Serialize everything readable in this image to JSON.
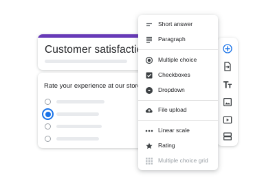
{
  "form": {
    "title": "Customer satisfaction",
    "question": "Rate your experience at our store",
    "accent_color": "#673ab7"
  },
  "question_options": [
    {
      "selected": false
    },
    {
      "selected": true
    },
    {
      "selected": false
    },
    {
      "selected": false
    }
  ],
  "menu": {
    "items": [
      {
        "label": "Short answer",
        "icon": "short-text-icon"
      },
      {
        "label": "Paragraph",
        "icon": "paragraph-icon"
      },
      {
        "label": "Multiple choice",
        "icon": "radio-button-icon"
      },
      {
        "label": "Checkboxes",
        "icon": "checkbox-icon"
      },
      {
        "label": "Dropdown",
        "icon": "dropdown-circle-icon"
      },
      {
        "label": "File upload",
        "icon": "cloud-upload-icon"
      },
      {
        "label": "Linear scale",
        "icon": "dots-icon"
      },
      {
        "label": "Rating",
        "icon": "star-icon"
      },
      {
        "label": "Multiple choice grid",
        "icon": "grid-icon",
        "disabled": true
      }
    ]
  },
  "toolbar": {
    "buttons": [
      {
        "icon": "add-circle-icon",
        "color": "#1a73e8"
      },
      {
        "icon": "import-icon"
      },
      {
        "icon": "title-text-icon"
      },
      {
        "icon": "image-icon"
      },
      {
        "icon": "video-icon"
      },
      {
        "icon": "section-icon"
      }
    ]
  }
}
